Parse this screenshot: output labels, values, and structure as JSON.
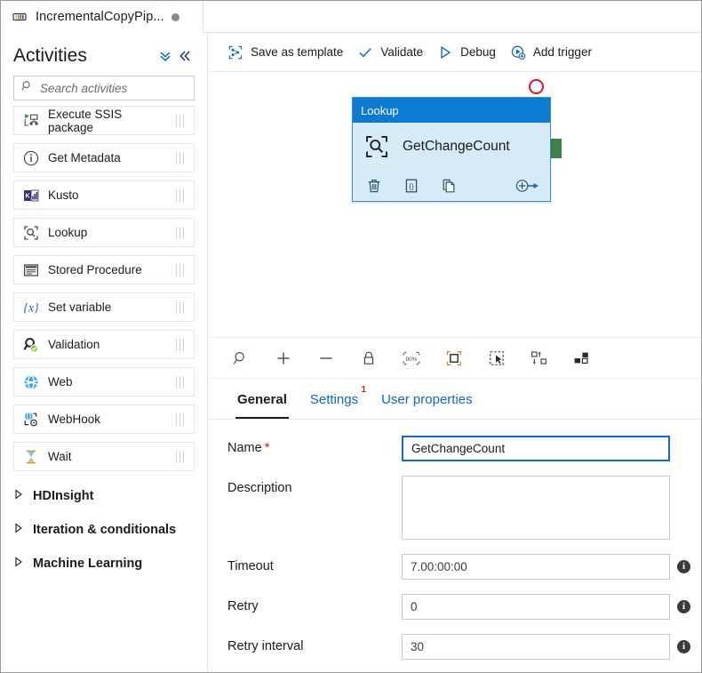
{
  "tab": {
    "title": "IncrementalCopyPip...",
    "icon": "pipeline-icon",
    "dirty_indicator": "●"
  },
  "sidebar": {
    "title": "Activities",
    "collapse_all_label": "»",
    "collapse_panel_label": "«",
    "search": {
      "placeholder": "Search activities",
      "value": "",
      "icon": "search-icon"
    },
    "items": [
      {
        "label": "Execute SSIS package",
        "icon": "execute-ssis-package-icon"
      },
      {
        "label": "Get Metadata",
        "icon": "get-metadata-icon"
      },
      {
        "label": "Kusto",
        "icon": "kusto-icon"
      },
      {
        "label": "Lookup",
        "icon": "lookup-icon"
      },
      {
        "label": "Stored Procedure",
        "icon": "stored-procedure-icon"
      },
      {
        "label": "Set variable",
        "icon": "set-variable-icon"
      },
      {
        "label": "Validation",
        "icon": "validation-icon"
      },
      {
        "label": "Web",
        "icon": "web-icon"
      },
      {
        "label": "WebHook",
        "icon": "webhook-icon"
      },
      {
        "label": "Wait",
        "icon": "wait-icon"
      }
    ],
    "groups": [
      {
        "label": "HDInsight",
        "icon": "chevron-right-icon"
      },
      {
        "label": "Iteration & conditionals",
        "icon": "chevron-right-icon"
      },
      {
        "label": "Machine Learning",
        "icon": "chevron-right-icon"
      }
    ]
  },
  "toolbar": {
    "commands": [
      {
        "label": "Save as template",
        "icon": "save-as-template-icon"
      },
      {
        "label": "Validate",
        "icon": "checkmark-icon"
      },
      {
        "label": "Debug",
        "icon": "play-triangle-icon"
      },
      {
        "label": "Add trigger",
        "icon": "add-trigger-icon"
      }
    ]
  },
  "canvas": {
    "node": {
      "type_label": "Lookup",
      "name": "GetChangeCount",
      "icon": "lookup-icon",
      "actions": [
        {
          "name": "delete-icon",
          "glyph": "trash"
        },
        {
          "name": "view-code-icon",
          "glyph": "code-braces"
        },
        {
          "name": "clone-icon",
          "glyph": "copy-pages"
        },
        {
          "name": "add-output-icon",
          "glyph": "plus-arrow"
        }
      ],
      "fail_port": "failure-output-port",
      "success_port": "success-output-port"
    },
    "zoom_controls": [
      {
        "name": "zoom-to-search-icon"
      },
      {
        "name": "zoom-in-icon"
      },
      {
        "name": "zoom-out-icon"
      },
      {
        "name": "lock-canvas-icon"
      },
      {
        "name": "zoom-100-percent-icon",
        "label": "00%"
      },
      {
        "name": "zoom-to-fit-icon"
      },
      {
        "name": "select-mode-icon"
      },
      {
        "name": "auto-align-icon"
      },
      {
        "name": "toggle-minimap-icon"
      }
    ]
  },
  "properties": {
    "tabs": [
      {
        "label": "General",
        "active": true,
        "badge": ""
      },
      {
        "label": "Settings",
        "active": false,
        "badge": "1"
      },
      {
        "label": "User properties",
        "active": false,
        "badge": ""
      }
    ],
    "fields": [
      {
        "label": "Name",
        "required": true,
        "value": "GetChangeCount",
        "placeholder": "",
        "control": "text",
        "focused": true,
        "info": false
      },
      {
        "label": "Description",
        "required": false,
        "value": "",
        "placeholder": "",
        "control": "textarea",
        "focused": false,
        "info": false
      },
      {
        "label": "Timeout",
        "required": false,
        "value": "7.00:00:00",
        "placeholder": "",
        "control": "text",
        "focused": false,
        "info": true
      },
      {
        "label": "Retry",
        "required": false,
        "value": "0",
        "placeholder": "",
        "control": "text",
        "focused": false,
        "info": true
      },
      {
        "label": "Retry interval",
        "required": false,
        "value": "30",
        "placeholder": "",
        "control": "text",
        "focused": false,
        "info": true
      }
    ],
    "info_glyph": "i"
  },
  "colors": {
    "accent_blue": "#0d7ad4",
    "link_blue": "#0f68b5",
    "node_body": "#d6eaf8",
    "node_border": "#3d8fc4",
    "fail_red": "#e81123",
    "success_green": "#3f8049",
    "required_red": "#c7201c"
  }
}
